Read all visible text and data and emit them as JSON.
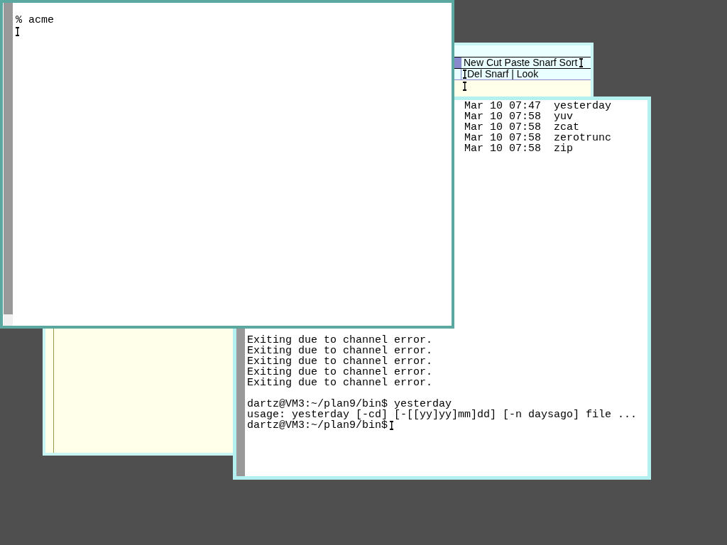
{
  "acme": {
    "column_tag": "New Cut Paste Snarf Sort",
    "window_tag": "Del Snarf | Look"
  },
  "terminal": {
    "listing": [
      "Mar 10 07:47  yesterday",
      "Mar 10 07:58  yuv",
      "Mar 10 07:58  zcat",
      "Mar 10 07:58  zerotrunc",
      "Mar 10 07:58  zip"
    ],
    "errors": [
      "Exiting due to channel error.",
      "Exiting due to channel error.",
      "Exiting due to channel error.",
      "Exiting due to channel error.",
      "Exiting due to channel error."
    ],
    "session": [
      "dartz@VM3:~/plan9/bin$ yesterday",
      "usage: yesterday [-cd] [-[[yy]yy]mm]dd] [-n daysago] file ...",
      "dartz@VM3:~/plan9/bin$"
    ]
  },
  "shell": {
    "lines": [
      "% acme"
    ]
  }
}
